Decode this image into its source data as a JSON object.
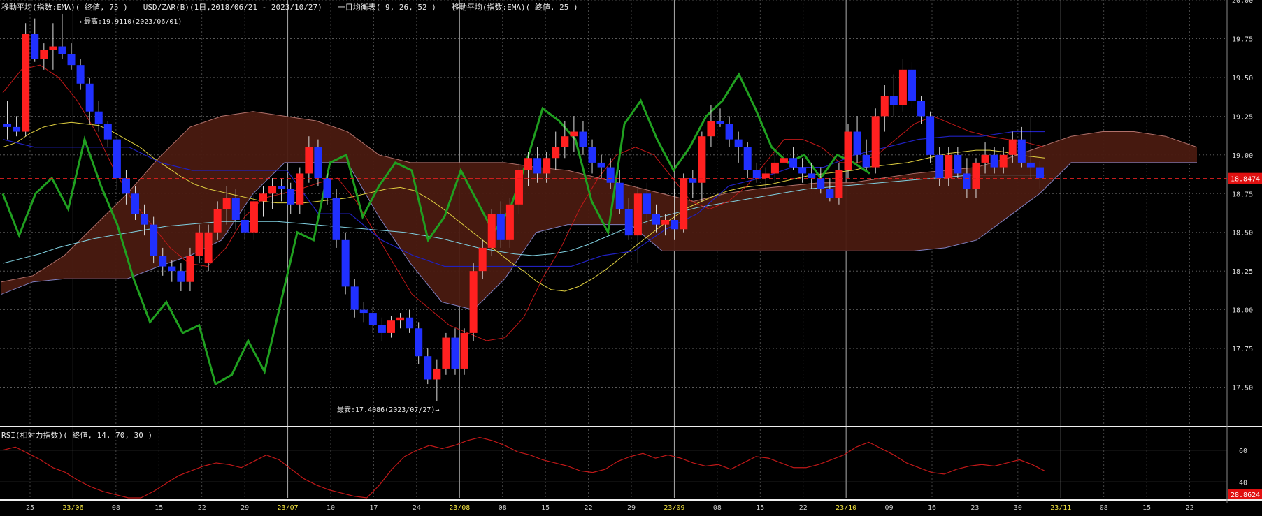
{
  "header": {
    "ema75": "移動平均(指数:EMA)( 終値, 75 )",
    "symbol": "USD/ZAR(B)(1日,2018/06/21 - 2023/10/27)",
    "ichimoku": "一目均衡表( 9, 26, 52 )",
    "ema25": "移動平均(指数:EMA)( 終値, 25 )"
  },
  "annotations": {
    "high": "←最高:19.9110(2023/06/01)",
    "low": "最安:17.4086(2023/07/27)→"
  },
  "rsi_header": "RSI(相対力指数)( 終値, 14, 70, 30 )",
  "current_price": "18.8474",
  "current_rsi": "28.8624",
  "colors": {
    "up": "#ff2020",
    "down": "#2030ff",
    "ema75": "#80d0e0",
    "ema25": "#e0d040",
    "tenkan": "#c01818",
    "kijun": "#2020c0",
    "chikou": "#20a020",
    "kumo_bull": "#4a1a10",
    "kumo_bear": "#2a2a6a",
    "rsi": "#c01818"
  },
  "chart_data": {
    "type": "candlestick",
    "price_axis": {
      "ylim": [
        17.25,
        20.0
      ],
      "ticks": [
        "20.00",
        "19.75",
        "19.50",
        "19.25",
        "19.00",
        "18.75",
        "18.50",
        "18.25",
        "18.00",
        "17.75",
        "17.50"
      ]
    },
    "rsi_axis": {
      "ylim": [
        30,
        70
      ],
      "ticks": [
        "60",
        "40"
      ]
    },
    "x_ticks": [
      "25",
      "23/06",
      "08",
      "15",
      "22",
      "29",
      "23/07",
      "10",
      "17",
      "24",
      "23/08",
      "08",
      "15",
      "22",
      "29",
      "23/09",
      "08",
      "15",
      "22",
      "23/10",
      "09",
      "16",
      "23",
      "30",
      "23/11",
      "08",
      "15",
      "22"
    ],
    "candles": [
      [
        19.2,
        19.35,
        19.1,
        19.18
      ],
      [
        19.18,
        19.25,
        19.12,
        19.15
      ],
      [
        19.15,
        19.85,
        19.12,
        19.78
      ],
      [
        19.78,
        19.88,
        19.6,
        19.62
      ],
      [
        19.62,
        19.72,
        19.55,
        19.68
      ],
      [
        19.68,
        19.85,
        19.55,
        19.7
      ],
      [
        19.7,
        19.91,
        19.62,
        19.65
      ],
      [
        19.65,
        19.72,
        19.55,
        19.58
      ],
      [
        19.58,
        19.62,
        19.42,
        19.46
      ],
      [
        19.46,
        19.5,
        19.2,
        19.28
      ],
      [
        19.28,
        19.35,
        19.15,
        19.2
      ],
      [
        19.2,
        19.22,
        19.05,
        19.1
      ],
      [
        19.1,
        19.12,
        18.78,
        18.85
      ],
      [
        18.85,
        18.9,
        18.68,
        18.75
      ],
      [
        18.75,
        18.8,
        18.58,
        18.62
      ],
      [
        18.62,
        18.68,
        18.48,
        18.55
      ],
      [
        18.55,
        18.6,
        18.3,
        18.35
      ],
      [
        18.35,
        18.4,
        18.22,
        18.28
      ],
      [
        18.28,
        18.32,
        18.18,
        18.25
      ],
      [
        18.25,
        18.3,
        18.12,
        18.18
      ],
      [
        18.18,
        18.4,
        18.12,
        18.35
      ],
      [
        18.35,
        18.55,
        18.3,
        18.5
      ],
      [
        18.3,
        18.55,
        18.25,
        18.5
      ],
      [
        18.5,
        18.7,
        18.45,
        18.65
      ],
      [
        18.65,
        18.8,
        18.55,
        18.72
      ],
      [
        18.72,
        18.78,
        18.52,
        18.58
      ],
      [
        18.58,
        18.65,
        18.45,
        18.5
      ],
      [
        18.5,
        18.75,
        18.45,
        18.7
      ],
      [
        18.7,
        18.8,
        18.6,
        18.75
      ],
      [
        18.75,
        18.85,
        18.65,
        18.8
      ],
      [
        18.8,
        18.85,
        18.7,
        18.78
      ],
      [
        18.78,
        18.82,
        18.62,
        18.68
      ],
      [
        18.68,
        18.92,
        18.62,
        18.88
      ],
      [
        18.88,
        19.12,
        18.82,
        19.05
      ],
      [
        19.05,
        19.1,
        18.8,
        18.85
      ],
      [
        18.85,
        18.88,
        18.68,
        18.72
      ],
      [
        18.72,
        18.78,
        18.4,
        18.45
      ],
      [
        18.45,
        18.5,
        18.1,
        18.15
      ],
      [
        18.15,
        18.2,
        17.95,
        18.0
      ],
      [
        18.0,
        18.05,
        17.92,
        17.98
      ],
      [
        17.98,
        18.02,
        17.85,
        17.9
      ],
      [
        17.9,
        17.95,
        17.8,
        17.85
      ],
      [
        17.85,
        17.96,
        17.82,
        17.93
      ],
      [
        17.93,
        17.98,
        17.88,
        17.95
      ],
      [
        17.95,
        18.0,
        17.85,
        17.88
      ],
      [
        17.88,
        17.92,
        17.65,
        17.7
      ],
      [
        17.7,
        17.75,
        17.52,
        17.55
      ],
      [
        17.55,
        17.68,
        17.41,
        17.62
      ],
      [
        17.62,
        17.85,
        17.58,
        17.82
      ],
      [
        17.82,
        17.88,
        17.58,
        17.62
      ],
      [
        17.62,
        17.88,
        17.58,
        17.85
      ],
      [
        17.85,
        18.3,
        17.8,
        18.25
      ],
      [
        18.25,
        18.45,
        18.2,
        18.4
      ],
      [
        18.4,
        18.65,
        18.35,
        18.62
      ],
      [
        18.62,
        18.7,
        18.4,
        18.45
      ],
      [
        18.45,
        18.72,
        18.4,
        18.68
      ],
      [
        18.68,
        18.95,
        18.62,
        18.9
      ],
      [
        18.9,
        19.02,
        18.8,
        18.98
      ],
      [
        18.98,
        19.05,
        18.82,
        18.88
      ],
      [
        18.88,
        19.02,
        18.82,
        18.98
      ],
      [
        18.98,
        19.15,
        18.9,
        19.05
      ],
      [
        19.05,
        19.22,
        18.98,
        19.12
      ],
      [
        19.12,
        19.25,
        19.02,
        19.15
      ],
      [
        19.15,
        19.22,
        19.0,
        19.05
      ],
      [
        19.05,
        19.1,
        18.88,
        18.95
      ],
      [
        18.95,
        19.0,
        18.85,
        18.92
      ],
      [
        18.92,
        18.98,
        18.78,
        18.82
      ],
      [
        18.82,
        18.9,
        18.62,
        18.65
      ],
      [
        18.65,
        18.72,
        18.45,
        18.48
      ],
      [
        18.48,
        18.8,
        18.3,
        18.75
      ],
      [
        18.75,
        18.82,
        18.55,
        18.62
      ],
      [
        18.62,
        18.68,
        18.5,
        18.55
      ],
      [
        18.55,
        18.62,
        18.48,
        18.58
      ],
      [
        18.58,
        18.78,
        18.45,
        18.52
      ],
      [
        18.52,
        18.88,
        18.5,
        18.85
      ],
      [
        18.85,
        18.9,
        18.72,
        18.82
      ],
      [
        18.82,
        19.15,
        18.7,
        19.12
      ],
      [
        19.12,
        19.32,
        19.05,
        19.22
      ],
      [
        19.22,
        19.3,
        19.18,
        19.2
      ],
      [
        19.2,
        19.25,
        19.05,
        19.1
      ],
      [
        19.1,
        19.15,
        18.95,
        19.05
      ],
      [
        19.05,
        19.08,
        18.85,
        18.9
      ],
      [
        18.9,
        18.95,
        18.82,
        18.85
      ],
      [
        18.85,
        18.92,
        18.78,
        18.88
      ],
      [
        18.88,
        19.02,
        18.82,
        18.95
      ],
      [
        18.95,
        19.02,
        18.88,
        18.98
      ],
      [
        18.98,
        19.05,
        18.9,
        18.92
      ],
      [
        18.92,
        18.98,
        18.82,
        18.88
      ],
      [
        18.88,
        18.95,
        18.78,
        18.85
      ],
      [
        18.85,
        18.92,
        18.75,
        18.78
      ],
      [
        18.78,
        18.85,
        18.7,
        18.72
      ],
      [
        18.72,
        18.95,
        18.68,
        18.9
      ],
      [
        18.9,
        19.2,
        18.85,
        19.15
      ],
      [
        19.15,
        19.25,
        18.95,
        19.0
      ],
      [
        19.0,
        19.1,
        18.9,
        18.92
      ],
      [
        18.92,
        19.3,
        18.88,
        19.25
      ],
      [
        19.25,
        19.45,
        19.15,
        19.38
      ],
      [
        19.38,
        19.52,
        19.25,
        19.32
      ],
      [
        19.32,
        19.62,
        19.28,
        19.55
      ],
      [
        19.55,
        19.6,
        19.3,
        19.35
      ],
      [
        19.35,
        19.38,
        19.2,
        19.25
      ],
      [
        19.25,
        19.28,
        18.95,
        19.0
      ],
      [
        19.0,
        19.05,
        18.8,
        18.85
      ],
      [
        18.85,
        19.05,
        18.8,
        19.0
      ],
      [
        19.0,
        19.05,
        18.85,
        18.88
      ],
      [
        18.88,
        18.98,
        18.72,
        18.78
      ],
      [
        18.78,
        18.98,
        18.72,
        18.95
      ],
      [
        18.95,
        19.08,
        18.88,
        19.0
      ],
      [
        19.0,
        19.05,
        18.88,
        18.92
      ],
      [
        18.92,
        19.05,
        18.88,
        19.0
      ],
      [
        19.0,
        19.15,
        18.95,
        19.1
      ],
      [
        19.1,
        19.18,
        18.92,
        18.95
      ],
      [
        18.95,
        19.25,
        18.85,
        18.92
      ],
      [
        18.92,
        18.96,
        18.78,
        18.85
      ]
    ],
    "ema25": [
      19.05,
      19.08,
      19.14,
      19.18,
      19.2,
      19.21,
      19.2,
      19.19,
      19.15,
      19.1,
      19.05,
      18.98,
      18.92,
      18.86,
      18.81,
      18.78,
      18.76,
      18.74,
      18.72,
      18.7,
      18.69,
      18.69,
      18.69,
      18.7,
      18.71,
      18.72,
      18.74,
      18.76,
      18.78,
      18.79,
      18.77,
      18.72,
      18.66,
      18.59,
      18.52,
      18.45,
      18.38,
      18.31,
      18.25,
      18.18,
      18.13,
      18.12,
      18.15,
      18.2,
      18.26,
      18.33,
      18.4,
      18.47,
      18.54,
      18.6,
      18.66,
      18.7,
      18.74,
      18.77,
      18.79,
      18.8,
      18.81,
      18.83,
      18.85,
      18.87,
      18.88,
      18.89,
      18.9,
      18.92,
      18.93,
      18.94,
      18.95,
      18.97,
      18.99,
      19.01,
      19.02,
      19.03,
      19.03,
      19.02,
      19.0,
      18.99,
      18.98
    ],
    "ema75": [
      18.3,
      18.33,
      18.36,
      18.4,
      18.43,
      18.46,
      18.48,
      18.5,
      18.52,
      18.54,
      18.55,
      18.56,
      18.57,
      18.57,
      18.57,
      18.57,
      18.56,
      18.55,
      18.54,
      18.53,
      18.52,
      18.51,
      18.5,
      18.48,
      18.46,
      18.43,
      18.4,
      18.38,
      18.36,
      18.35,
      18.36,
      18.38,
      18.42,
      18.47,
      18.52,
      18.56,
      18.6,
      18.63,
      18.66,
      18.68,
      18.7,
      18.72,
      18.74,
      18.76,
      18.78,
      18.79,
      18.8,
      18.81,
      18.82,
      18.83,
      18.84,
      18.85,
      18.86,
      18.87,
      18.87,
      18.87,
      18.87,
      18.87
    ],
    "tenkan": [
      19.4,
      19.55,
      19.58,
      19.5,
      19.35,
      19.15,
      18.9,
      18.7,
      18.55,
      18.4,
      18.3,
      18.28,
      18.4,
      18.6,
      18.72,
      18.75,
      18.78,
      18.82,
      18.85,
      18.7,
      18.5,
      18.3,
      18.1,
      18.0,
      17.9,
      17.85,
      17.8,
      17.82,
      17.95,
      18.2,
      18.4,
      18.65,
      18.85,
      19.0,
      19.05,
      19.0,
      18.85,
      18.7,
      18.65,
      18.7,
      18.8,
      18.95,
      19.1,
      19.1,
      19.05,
      18.95,
      18.95,
      19.0,
      19.1,
      19.2,
      19.25,
      19.2,
      19.15,
      19.12,
      19.1,
      19.08,
      19.05
    ],
    "kijun": [
      19.1,
      19.05,
      19.05,
      19.05,
      19.05,
      18.95,
      18.9,
      18.9,
      18.9,
      18.9,
      18.62,
      18.62,
      18.45,
      18.35,
      18.28,
      18.28,
      18.28,
      18.28,
      18.28,
      18.35,
      18.38,
      18.52,
      18.62,
      18.8,
      18.85,
      18.92,
      18.92,
      19.0,
      19.05,
      19.1,
      19.12,
      19.12,
      19.15,
      19.15
    ],
    "chikou": [
      18.75,
      18.48,
      18.75,
      18.85,
      18.65,
      19.1,
      18.8,
      18.55,
      18.2,
      17.92,
      18.05,
      17.85,
      17.9,
      17.52,
      17.58,
      17.8,
      17.6,
      18.05,
      18.5,
      18.45,
      18.95,
      19.0,
      18.6,
      18.8,
      18.95,
      18.9,
      18.45,
      18.6,
      18.9,
      18.7,
      18.5,
      18.65,
      18.95,
      19.3,
      19.22,
      19.1,
      18.7,
      18.5,
      19.2,
      19.35,
      19.1,
      18.9,
      19.05,
      19.25,
      19.35,
      19.52,
      19.3,
      19.05,
      18.95,
      19.0,
      18.85,
      19.0,
      18.95,
      18.88
    ],
    "kumo": {
      "span_a": [
        18.18,
        18.22,
        18.35,
        18.55,
        18.75,
        18.98,
        19.18,
        19.25,
        19.28,
        19.25,
        19.22,
        19.15,
        19.0,
        18.95,
        18.95,
        18.95,
        18.95,
        18.92,
        18.9,
        18.85,
        18.8,
        18.75,
        18.7,
        18.75,
        18.78,
        18.8,
        18.82,
        18.82,
        18.85,
        18.88,
        18.9,
        18.92,
        18.98,
        19.05,
        19.12,
        19.15,
        19.15,
        19.12,
        19.05
      ],
      "span_b": [
        18.1,
        18.18,
        18.2,
        18.2,
        18.2,
        18.28,
        18.35,
        18.45,
        18.75,
        18.95,
        18.95,
        18.95,
        18.6,
        18.3,
        18.05,
        18.0,
        18.2,
        18.5,
        18.55,
        18.55,
        18.55,
        18.38,
        18.38,
        18.38,
        18.38,
        18.38,
        18.38,
        18.38,
        18.38,
        18.38,
        18.4,
        18.45,
        18.6,
        18.75,
        18.95,
        18.95,
        18.95,
        18.95,
        18.95
      ]
    },
    "rsi": [
      60,
      62,
      58,
      54,
      49,
      46,
      41,
      37,
      34,
      32,
      30,
      30,
      34,
      39,
      44,
      47,
      50,
      52,
      51,
      49,
      53,
      57,
      54,
      48,
      42,
      38,
      35,
      33,
      31,
      30,
      38,
      48,
      56,
      60,
      63,
      61,
      63,
      66,
      68,
      66,
      63,
      59,
      57,
      54,
      52,
      50,
      47,
      46,
      48,
      53,
      56,
      58,
      55,
      57,
      55,
      52,
      50,
      51,
      48,
      52,
      56,
      55,
      52,
      49,
      49,
      51,
      54,
      57,
      62,
      65,
      61,
      57,
      52,
      49,
      46,
      45,
      48,
      50,
      51,
      50,
      52,
      54,
      51,
      47
    ]
  }
}
